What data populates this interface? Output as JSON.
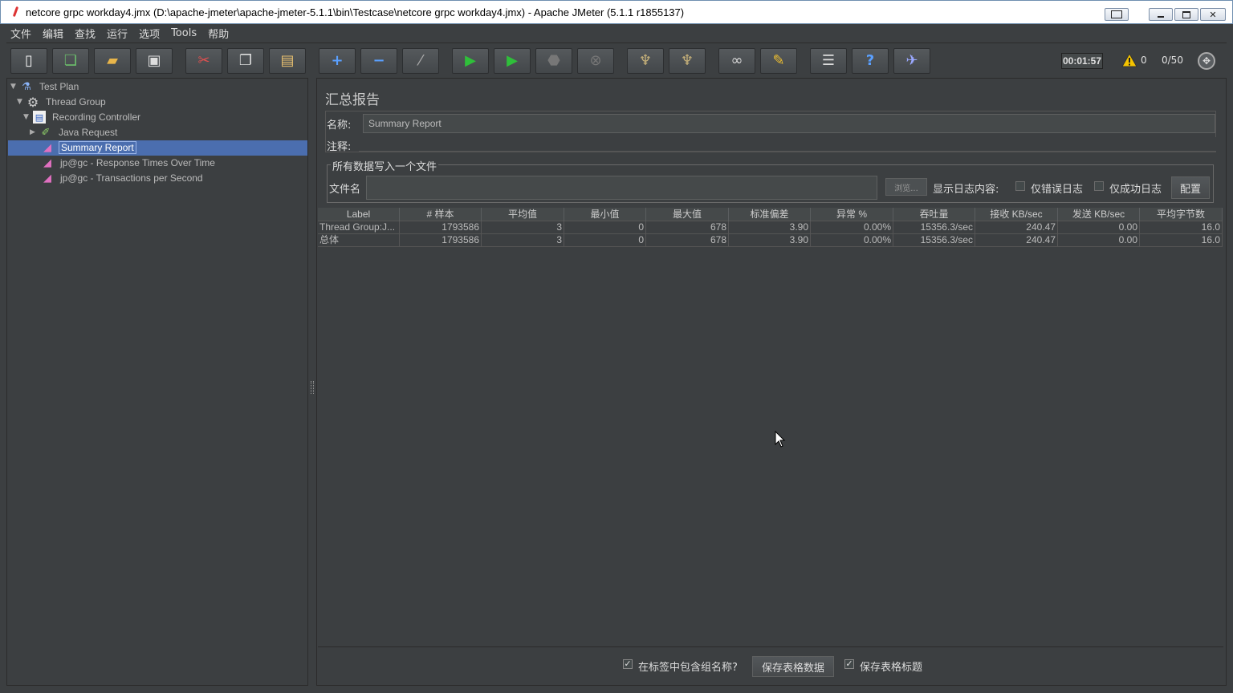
{
  "window": {
    "title": "netcore grpc workday4.jmx (D:\\apache-jmeter\\apache-jmeter-5.1.1\\bin\\Testcase\\netcore grpc workday4.jmx) - Apache JMeter (5.1.1 r1855137)"
  },
  "menu": [
    "文件",
    "编辑",
    "查找",
    "运行",
    "选项",
    "Tools",
    "帮助"
  ],
  "toolbar": {
    "buttons": [
      {
        "name": "new-button",
        "icon": "new-file-icon"
      },
      {
        "name": "templates-button",
        "icon": "templates-icon"
      },
      {
        "name": "open-button",
        "icon": "open-folder-icon"
      },
      {
        "name": "save-button",
        "icon": "save-disk-icon"
      },
      {
        "name": "cut-button",
        "icon": "scissors-icon"
      },
      {
        "name": "copy-button",
        "icon": "copy-icon"
      },
      {
        "name": "paste-button",
        "icon": "clipboard-icon"
      },
      {
        "name": "expand-all-button",
        "icon": "plus-icon"
      },
      {
        "name": "collapse-all-button",
        "icon": "minus-icon"
      },
      {
        "name": "toggle-button",
        "icon": "wand-icon"
      },
      {
        "name": "start-button",
        "icon": "play-icon"
      },
      {
        "name": "start-no-pause-button",
        "icon": "play-no-timer-icon"
      },
      {
        "name": "stop-button",
        "icon": "stop-icon"
      },
      {
        "name": "shutdown-button",
        "icon": "shutdown-icon"
      },
      {
        "name": "clear-button",
        "icon": "broom-icon"
      },
      {
        "name": "clear-all-button",
        "icon": "broom-all-icon"
      },
      {
        "name": "search-button",
        "icon": "binoculars-icon"
      },
      {
        "name": "reset-search-button",
        "icon": "eraser-icon"
      },
      {
        "name": "function-helper-button",
        "icon": "list-icon"
      },
      {
        "name": "help-button",
        "icon": "help-book-icon"
      },
      {
        "name": "remote-button",
        "icon": "remote-icon"
      }
    ],
    "elapsed_time": "00:01:57",
    "warning_count": "0",
    "thread_status": "0/50"
  },
  "tree": [
    {
      "label": "Test Plan",
      "icon": "flask-icon",
      "expanded": true
    },
    {
      "label": "Thread Group",
      "icon": "gear-icon",
      "expanded": true
    },
    {
      "label": "Recording Controller",
      "icon": "controller-icon",
      "expanded": true
    },
    {
      "label": "Java Request",
      "icon": "pipette-icon",
      "expanded": false
    },
    {
      "label": "Summary Report",
      "icon": "chart-icon",
      "selected": true
    },
    {
      "label": "jp@gc - Response Times Over Time",
      "icon": "chart-icon"
    },
    {
      "label": "jp@gc - Transactions per Second",
      "icon": "chart-icon"
    }
  ],
  "panel": {
    "title": "汇总报告",
    "name_label": "名称:",
    "name_value": "Summary Report",
    "comment_label": "注释:",
    "file_group_title": "所有数据写入一个文件",
    "file_label": "文件名",
    "browse_label": "浏览...",
    "log_content_label": "显示日志内容:",
    "errors_only_label": "仅错误日志",
    "success_only_label": "仅成功日志",
    "configure_label": "配置"
  },
  "table": {
    "columns": [
      "Label",
      "# 样本",
      "平均值",
      "最小值",
      "最大值",
      "标准偏差",
      "异常 %",
      "吞吐量",
      "接收 KB/sec",
      "发送 KB/sec",
      "平均字节数"
    ],
    "rows": [
      [
        "Thread Group:J...",
        "1793586",
        "3",
        "0",
        "678",
        "3.90",
        "0.00%",
        "15356.3/sec",
        "240.47",
        "0.00",
        "16.0"
      ],
      [
        "总体",
        "1793586",
        "3",
        "0",
        "678",
        "3.90",
        "0.00%",
        "15356.3/sec",
        "240.47",
        "0.00",
        "16.0"
      ]
    ]
  },
  "bottom": {
    "include_group_label": "在标签中包含组名称?",
    "save_table_label": "保存表格数据",
    "save_header_label": "保存表格标题"
  }
}
